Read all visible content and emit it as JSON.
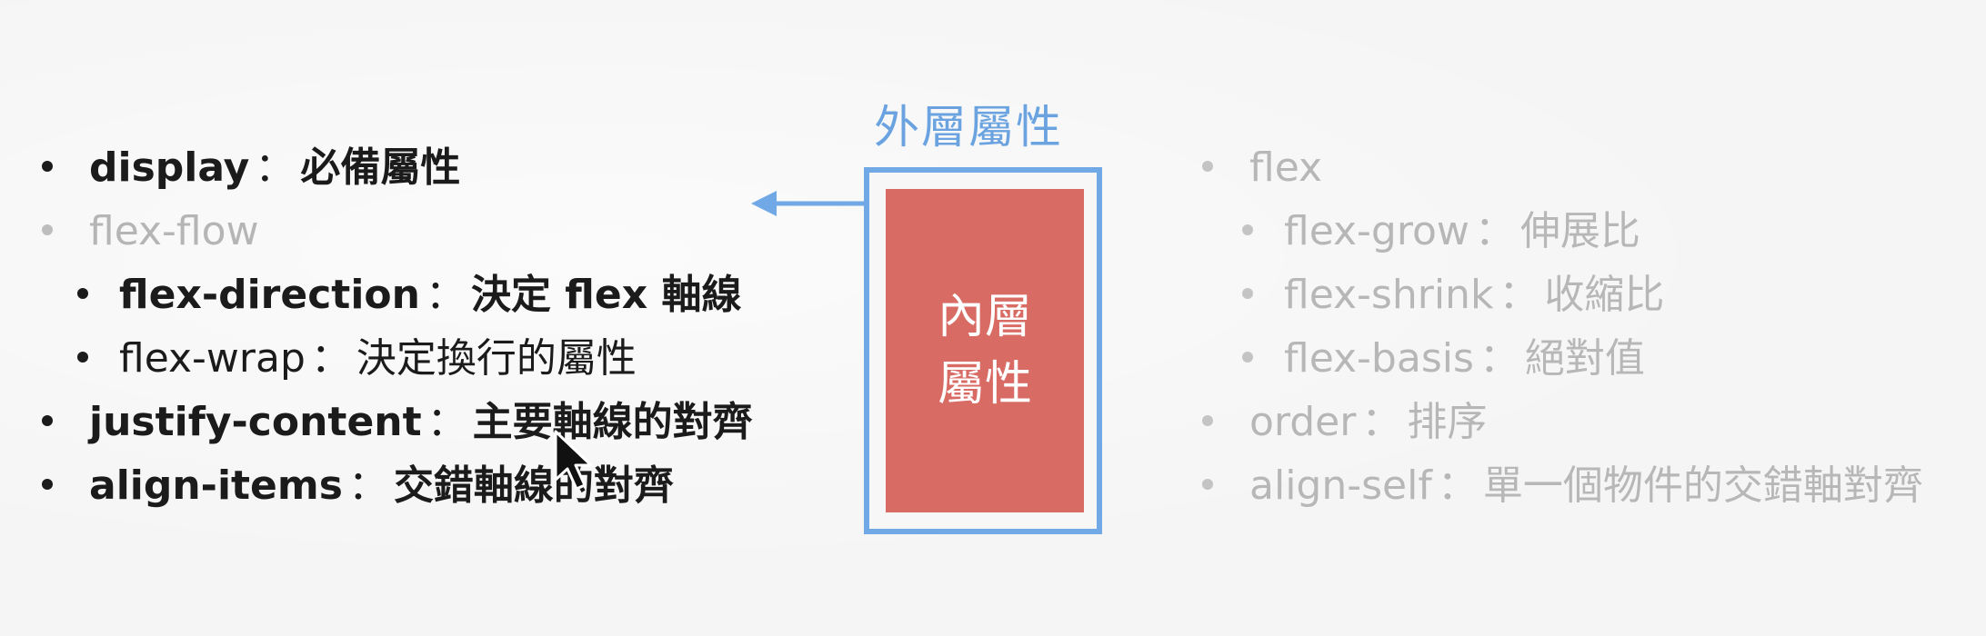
{
  "left_list": [
    {
      "key": "display",
      "sep": "：",
      "desc": "必備屬性"
    },
    {
      "key": "flex-flow",
      "sep": "",
      "desc": ""
    },
    {
      "key": "flex-direction",
      "sep": "：",
      "desc": "決定 flex 軸線"
    },
    {
      "key": "flex-wrap",
      "sep": "：",
      "desc": "決定換行的屬性"
    },
    {
      "key": "justify-content",
      "sep": "：",
      "desc": "主要軸線的對齊"
    },
    {
      "key": "align-items",
      "sep": "：",
      "desc": "交錯軸線的對齊"
    }
  ],
  "center": {
    "outer_label": "外層屬性",
    "inner_line1": "內層",
    "inner_line2": "屬性"
  },
  "right_list": [
    {
      "key": "flex",
      "sep": "",
      "desc": ""
    },
    {
      "key": "flex-grow",
      "sep": "：",
      "desc": "伸展比"
    },
    {
      "key": "flex-shrink",
      "sep": "：",
      "desc": "收縮比"
    },
    {
      "key": "flex-basis",
      "sep": "：",
      "desc": "絕對值"
    },
    {
      "key": "order",
      "sep": "：",
      "desc": "排序"
    },
    {
      "key": "align-self",
      "sep": "：",
      "desc": "單一個物件的交錯軸對齊"
    }
  ],
  "colors": {
    "outer_border": "#71a9e6",
    "inner_fill": "#d96b65",
    "label_blue": "#6aa3e0",
    "muted_text": "#b5b5b5",
    "dark_text": "#1b1b1b"
  },
  "icons": [
    "left-arrow-icon",
    "mouse-cursor-icon",
    "bullet-icon"
  ]
}
